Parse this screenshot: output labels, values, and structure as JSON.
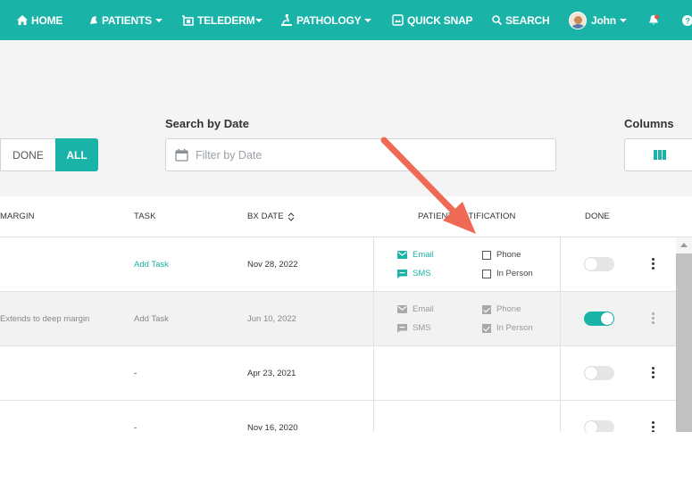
{
  "navbar": {
    "home": "HOME",
    "patients": "PATIENTS",
    "telederm": "TELEDERM",
    "pathology": "PATHOLOGY",
    "quick_snap": "QUICK SNAP",
    "search": "SEARCH",
    "user": "John",
    "accent_color": "#1ab3a8"
  },
  "filters": {
    "search_by_date_label": "Search by Date",
    "date_placeholder": "Filter by Date",
    "columns_label": "Columns",
    "done_label": "DONE",
    "all_label": "ALL"
  },
  "table": {
    "headers": {
      "margin": "MARGIN",
      "task": "TASK",
      "bx_date": "BX DATE",
      "patient_notification": "PATIENT NOTIFICATION",
      "done": "DONE"
    },
    "rows": [
      {
        "margin": "",
        "task": "Add Task",
        "bx_date": "Nov 28, 2022",
        "email": "Email",
        "sms": "SMS",
        "phone": "Phone",
        "in_person": "In Person",
        "done": false
      },
      {
        "margin": "Extends to deep margin",
        "task": "Add Task",
        "bx_date": "Jun 10, 2022",
        "email": "Email",
        "sms": "SMS",
        "phone": "Phone",
        "in_person": "In Person",
        "done": true
      },
      {
        "margin": "",
        "task": "-",
        "bx_date": "Apr 23, 2021",
        "done": false
      },
      {
        "margin": "",
        "task": "-",
        "bx_date": "Nov 16, 2020",
        "done": false
      }
    ]
  },
  "annotation": {
    "arrow_color": "#ef6a55"
  }
}
